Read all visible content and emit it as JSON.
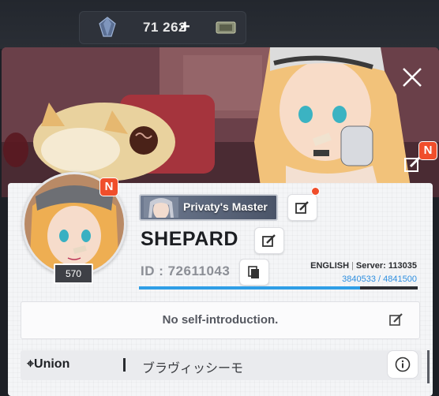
{
  "currency": {
    "gem_amount": "71 262",
    "plus_label": "+",
    "gem_icon": "gem-icon",
    "ticket_icon": "ticket-icon"
  },
  "badges": {
    "avatar_badge": "N",
    "banner_badge": "N"
  },
  "profile": {
    "title_plate": "Privaty's Master",
    "username": "SHEPARD",
    "level": "570",
    "id_text": "ID : 72611043",
    "language": "ENGLISH",
    "server": "Server: 113035",
    "exp_text": "3840533 / 4841500",
    "exp_progress": 0.793,
    "intro": "No self-introduction."
  },
  "union": {
    "label": "Union",
    "name": "ブラヴィッシーモ"
  },
  "colors": {
    "accent_blue": "#2f9ee6",
    "badge_red": "#f04e2b",
    "panel_bg": "#f4f5f7"
  }
}
